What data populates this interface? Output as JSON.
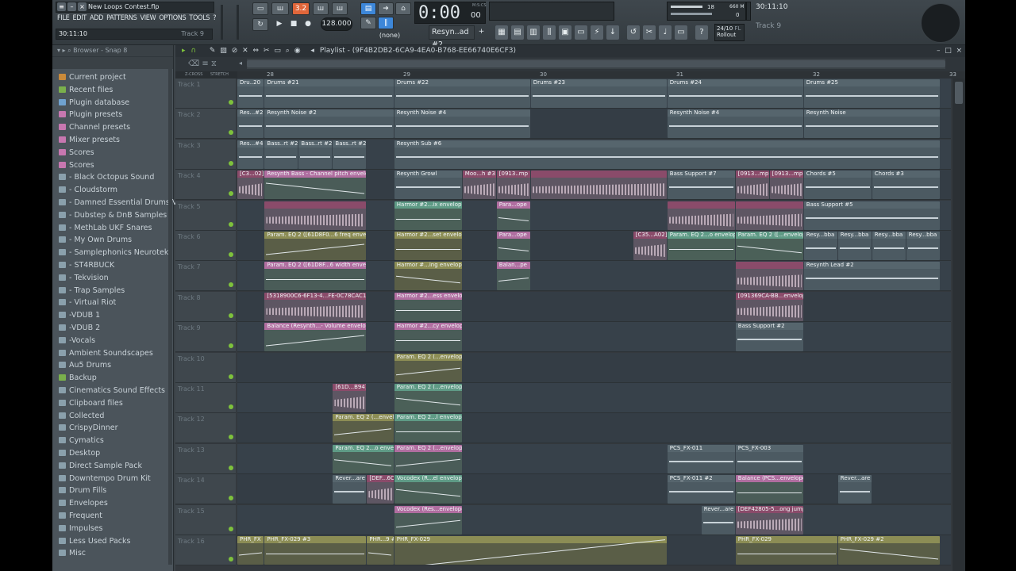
{
  "app": {
    "project_file": "New Loops Contest.flp",
    "menu": [
      "FILE",
      "EDIT",
      "ADD",
      "PATTERNS",
      "VIEW",
      "OPTIONS",
      "TOOLS",
      "?"
    ],
    "hint_time": "30:11:10",
    "hint_track": "Track 9",
    "pattern_num": "3.2",
    "tempo": "128.000",
    "time_display": "0:00",
    "time_sub": "00",
    "time_unit": "M:S:CS",
    "snap_label": "(none)",
    "pattern_selector": "Resyn..ad #2",
    "cpu_value": "18",
    "mem_value": "660 M",
    "voices": "0",
    "top_hint_time": "30:11:10",
    "top_hint_track": "Track 9",
    "rollout_date": "24/10",
    "rollout_label": "Rollout",
    "fl_label": "FL"
  },
  "browser": {
    "header": "Browser - Snap 8",
    "items": [
      {
        "label": "Current project",
        "color": "#c98a3a"
      },
      {
        "label": "Recent files",
        "color": "#7ab04c"
      },
      {
        "label": "Plugin database",
        "color": "#6fa2d0"
      },
      {
        "label": "Plugin presets",
        "color": "#c777b0"
      },
      {
        "label": "Channel presets",
        "color": "#c777b0"
      },
      {
        "label": "Mixer presets",
        "color": "#c777b0"
      },
      {
        "label": "Scores",
        "color": "#c777b0"
      },
      {
        "label": "Scores",
        "color": "#c777b0"
      },
      {
        "label": "- Black Octopus Sound",
        "color": "#8aa0ac"
      },
      {
        "label": "- Cloudstorm",
        "color": "#8aa0ac"
      },
      {
        "label": "- Damned Essential Drums V2",
        "color": "#8aa0ac"
      },
      {
        "label": "- Dubstep & DnB Samples",
        "color": "#8aa0ac"
      },
      {
        "label": "- MethLab UKF Snares",
        "color": "#8aa0ac"
      },
      {
        "label": "- My Own Drums",
        "color": "#8aa0ac"
      },
      {
        "label": "- Samplephonics Neurotek",
        "color": "#8aa0ac"
      },
      {
        "label": "- ST4RBUCK",
        "color": "#8aa0ac"
      },
      {
        "label": "- Tekvision",
        "color": "#8aa0ac"
      },
      {
        "label": "- Trap Samples",
        "color": "#8aa0ac"
      },
      {
        "label": "- Virtual Riot",
        "color": "#8aa0ac"
      },
      {
        "label": "-VDUB 1",
        "color": "#8aa0ac"
      },
      {
        "label": "-VDUB 2",
        "color": "#8aa0ac"
      },
      {
        "label": "-Vocals",
        "color": "#8aa0ac"
      },
      {
        "label": "Ambient Soundscapes",
        "color": "#8aa0ac"
      },
      {
        "label": "Au5 Drums",
        "color": "#8aa0ac"
      },
      {
        "label": "Backup",
        "color": "#7ab04c"
      },
      {
        "label": "Cinematics Sound Effects",
        "color": "#8aa0ac"
      },
      {
        "label": "Clipboard files",
        "color": "#8aa0ac"
      },
      {
        "label": "Collected",
        "color": "#8aa0ac"
      },
      {
        "label": "CrispyDinner",
        "color": "#8aa0ac"
      },
      {
        "label": "Cymatics",
        "color": "#8aa0ac"
      },
      {
        "label": "Desktop",
        "color": "#8aa0ac"
      },
      {
        "label": "Direct Sample Pack",
        "color": "#8aa0ac"
      },
      {
        "label": "Downtempo Drum Kit",
        "color": "#8aa0ac"
      },
      {
        "label": "Drum Fills",
        "color": "#8aa0ac"
      },
      {
        "label": "Envelopes",
        "color": "#8aa0ac"
      },
      {
        "label": "Frequent",
        "color": "#8aa0ac"
      },
      {
        "label": "Impulses",
        "color": "#8aa0ac"
      },
      {
        "label": "Less Used Packs",
        "color": "#8aa0ac"
      },
      {
        "label": "Misc",
        "color": "#8aa0ac"
      }
    ]
  },
  "playlist": {
    "title": "Playlist - (9F4B2DB2-6CA9-4EA0-B768-EE66740E6CF3)",
    "zoom_labels": [
      "Z-CROSS",
      "STRETCH"
    ],
    "ruler": [
      "28",
      "29",
      "30",
      "31",
      "32",
      "33"
    ],
    "tracks": [
      "Track 1",
      "Track 2",
      "Track 3",
      "Track 4",
      "Track 5",
      "Track 6",
      "Track 7",
      "Track 8",
      "Track 9",
      "Track 10",
      "Track 11",
      "Track 12",
      "Track 13",
      "Track 14",
      "Track 15",
      "Track 16"
    ],
    "clips": [
      {
        "t": 0,
        "s": 0,
        "w": 0.4,
        "k": "pat",
        "l": "Dru..20"
      },
      {
        "t": 0,
        "s": 0.4,
        "w": 1.9,
        "k": "pat",
        "l": "Drums #21"
      },
      {
        "t": 0,
        "s": 2.3,
        "w": 2.0,
        "k": "pat",
        "l": "Drums #22"
      },
      {
        "t": 0,
        "s": 4.3,
        "w": 2.0,
        "k": "pat",
        "l": "Drums #23"
      },
      {
        "t": 0,
        "s": 6.3,
        "w": 2.0,
        "k": "pat",
        "l": "Drums #24"
      },
      {
        "t": 0,
        "s": 8.3,
        "w": 2.0,
        "k": "pat",
        "l": "Drums #25"
      },
      {
        "t": 1,
        "s": 0,
        "w": 0.4,
        "k": "pat",
        "l": "Res...#2"
      },
      {
        "t": 1,
        "s": 0.4,
        "w": 1.9,
        "k": "pat",
        "l": "Resynth Noise #2"
      },
      {
        "t": 1,
        "s": 2.3,
        "w": 2.0,
        "k": "pat",
        "l": "Resynth Noise #4"
      },
      {
        "t": 1,
        "s": 6.3,
        "w": 2.0,
        "k": "pat",
        "l": "Resynth Noise #4"
      },
      {
        "t": 1,
        "s": 8.3,
        "w": 2.0,
        "k": "pat",
        "l": "Resynth Noise"
      },
      {
        "t": 2,
        "s": 0,
        "w": 0.4,
        "k": "pat",
        "l": "Res...#4"
      },
      {
        "t": 2,
        "s": 0.4,
        "w": 0.5,
        "k": "pat",
        "l": "Bass..rt #2"
      },
      {
        "t": 2,
        "s": 0.9,
        "w": 0.5,
        "k": "pat",
        "l": "Bass..rt #2"
      },
      {
        "t": 2,
        "s": 1.4,
        "w": 0.5,
        "k": "pat",
        "l": "Bass..rt #2"
      },
      {
        "t": 2,
        "s": 2.3,
        "w": 8.0,
        "k": "pat",
        "l": "Resynth Sub #6"
      },
      {
        "t": 3,
        "s": 0,
        "w": 0.4,
        "k": "aud",
        "l": "[C3...02]"
      },
      {
        "t": 3,
        "s": 0.4,
        "w": 1.5,
        "k": "env",
        "l": "Resynth Bass - Channel pitch envelope"
      },
      {
        "t": 3,
        "s": 2.3,
        "w": 1.0,
        "k": "pat",
        "l": "Resynth Growl"
      },
      {
        "t": 3,
        "s": 3.3,
        "w": 0.5,
        "k": "aud",
        "l": "Moo...h #3"
      },
      {
        "t": 3,
        "s": 3.8,
        "w": 0.5,
        "k": "aud",
        "l": "[0913..mp"
      },
      {
        "t": 3,
        "s": 4.3,
        "w": 2.0,
        "k": "aud",
        "l": ""
      },
      {
        "t": 3,
        "s": 6.3,
        "w": 1.0,
        "k": "pat",
        "l": "Bass Support #7"
      },
      {
        "t": 3,
        "s": 7.3,
        "w": 0.5,
        "k": "aud",
        "l": "[0913...mp"
      },
      {
        "t": 3,
        "s": 7.8,
        "w": 0.5,
        "k": "aud",
        "l": "[0913...mp"
      },
      {
        "t": 3,
        "s": 8.3,
        "w": 1.0,
        "k": "pat",
        "l": "Chords #5"
      },
      {
        "t": 3,
        "s": 9.3,
        "w": 1.0,
        "k": "pat",
        "l": "Chords #3"
      },
      {
        "t": 4,
        "s": 0.4,
        "w": 1.5,
        "k": "aud",
        "l": ""
      },
      {
        "t": 4,
        "s": 2.3,
        "w": 1.0,
        "k": "grn",
        "l": "Harmor #2...ix envelope"
      },
      {
        "t": 4,
        "s": 3.8,
        "w": 0.5,
        "k": "env",
        "l": "Para...ope"
      },
      {
        "t": 4,
        "s": 6.3,
        "w": 1.0,
        "k": "aud",
        "l": ""
      },
      {
        "t": 4,
        "s": 7.3,
        "w": 1.0,
        "k": "aud",
        "l": ""
      },
      {
        "t": 4,
        "s": 8.3,
        "w": 2.0,
        "k": "pat",
        "l": "Bass Support #5"
      },
      {
        "t": 5,
        "s": 0.4,
        "w": 1.5,
        "k": "env2",
        "l": "Param. EQ 2 ([61D8F0...6 freq envelope"
      },
      {
        "t": 5,
        "s": 2.3,
        "w": 1.0,
        "k": "env2",
        "l": "Harmor #2...set envelope"
      },
      {
        "t": 5,
        "s": 3.8,
        "w": 0.5,
        "k": "env",
        "l": "Para...ope"
      },
      {
        "t": 5,
        "s": 5.8,
        "w": 0.5,
        "k": "aud",
        "l": "[C35...A02]"
      },
      {
        "t": 5,
        "s": 6.3,
        "w": 1.0,
        "k": "grn",
        "l": "Param. EQ 2...o envelope"
      },
      {
        "t": 5,
        "s": 7.3,
        "w": 1.0,
        "k": "grn",
        "l": "Param. EQ 2 ([...envelope"
      },
      {
        "t": 5,
        "s": 8.3,
        "w": 0.5,
        "k": "pat",
        "l": "Resy...bba"
      },
      {
        "t": 5,
        "s": 8.8,
        "w": 0.5,
        "k": "pat",
        "l": "Resy...bba"
      },
      {
        "t": 5,
        "s": 9.3,
        "w": 0.5,
        "k": "pat",
        "l": "Resy...bba"
      },
      {
        "t": 5,
        "s": 9.8,
        "w": 0.5,
        "k": "pat",
        "l": "Resy...bba"
      },
      {
        "t": 6,
        "s": 0.4,
        "w": 1.5,
        "k": "env",
        "l": "Param. EQ 2 ([61D8F...6 width envelope"
      },
      {
        "t": 6,
        "s": 2.3,
        "w": 1.0,
        "k": "env2",
        "l": "Harmor #...ing envelope"
      },
      {
        "t": 6,
        "s": 3.8,
        "w": 0.5,
        "k": "env",
        "l": "Balan...pe"
      },
      {
        "t": 6,
        "s": 7.3,
        "w": 1.0,
        "k": "aud",
        "l": ""
      },
      {
        "t": 6,
        "s": 8.3,
        "w": 2.0,
        "k": "pat",
        "l": "Resynth Lead #2"
      },
      {
        "t": 7,
        "s": 0.4,
        "w": 1.5,
        "k": "aud",
        "l": "[5318900C6-6F13-4...FE-0C78CAC190C8]"
      },
      {
        "t": 7,
        "s": 2.3,
        "w": 1.0,
        "k": "env",
        "l": "Harmor #2...ess envelope"
      },
      {
        "t": 7,
        "s": 7.3,
        "w": 1.0,
        "k": "aud",
        "l": "[091369CA-BB...envelope"
      },
      {
        "t": 8,
        "s": 0.4,
        "w": 1.5,
        "k": "env",
        "l": "Balance (Resynth...- Volume envelope"
      },
      {
        "t": 8,
        "s": 2.3,
        "w": 1.0,
        "k": "env",
        "l": "Harmor #2...cy envelope"
      },
      {
        "t": 8,
        "s": 7.3,
        "w": 1.0,
        "k": "pat",
        "l": "Bass Support #2"
      },
      {
        "t": 9,
        "s": 2.3,
        "w": 1.0,
        "k": "env2",
        "l": "Param. EQ 2 (...envelope"
      },
      {
        "t": 10,
        "s": 1.4,
        "w": 0.5,
        "k": "aud",
        "l": "[61D...B94]"
      },
      {
        "t": 10,
        "s": 2.3,
        "w": 1.0,
        "k": "grn",
        "l": "Param. EQ 2 (...envelope"
      },
      {
        "t": 11,
        "s": 1.4,
        "w": 0.9,
        "k": "env2",
        "l": "Param. EQ 2 (...envelope"
      },
      {
        "t": 11,
        "s": 2.3,
        "w": 1.0,
        "k": "grn",
        "l": "Param. EQ 2...l envelope"
      },
      {
        "t": 12,
        "s": 1.4,
        "w": 0.9,
        "k": "grn",
        "l": "Param. EQ 2...o envelope"
      },
      {
        "t": 12,
        "s": 2.3,
        "w": 1.0,
        "k": "env",
        "l": "Param. EQ 2 (...envelope"
      },
      {
        "t": 12,
        "s": 6.3,
        "w": 1.0,
        "k": "pat",
        "l": "PCS_FX-011"
      },
      {
        "t": 12,
        "s": 7.3,
        "w": 1.0,
        "k": "pat",
        "l": "PCS_FX-003"
      },
      {
        "t": 13,
        "s": 1.4,
        "w": 0.5,
        "k": "pat",
        "l": "Rever...are"
      },
      {
        "t": 13,
        "s": 1.9,
        "w": 0.4,
        "k": "aud",
        "l": "[DEF...6C8]"
      },
      {
        "t": 13,
        "s": 2.3,
        "w": 1.0,
        "k": "grn",
        "l": "Vocodex (R...el envelope"
      },
      {
        "t": 13,
        "s": 6.3,
        "w": 1.0,
        "k": "pat",
        "l": "PCS_FX-011 #2"
      },
      {
        "t": 13,
        "s": 7.3,
        "w": 1.0,
        "k": "env",
        "l": "Balance (PCS...envelope"
      },
      {
        "t": 13,
        "s": 8.8,
        "w": 0.5,
        "k": "pat",
        "l": "Rever...are"
      },
      {
        "t": 14,
        "s": 2.3,
        "w": 1.0,
        "k": "env",
        "l": "Vocodex (Res...envelope"
      },
      {
        "t": 14,
        "s": 6.8,
        "w": 0.5,
        "k": "pat",
        "l": "Rever...are"
      },
      {
        "t": 14,
        "s": 7.3,
        "w": 1.0,
        "k": "aud",
        "l": "[DEF42805-5...ong jump"
      },
      {
        "t": 15,
        "s": 0,
        "w": 0.4,
        "k": "env2",
        "l": "PHR_FX"
      },
      {
        "t": 15,
        "s": 0.4,
        "w": 1.5,
        "k": "env2",
        "l": "PHR_FX-029 #3"
      },
      {
        "t": 15,
        "s": 1.9,
        "w": 0.4,
        "k": "env2",
        "l": "PHR...9 #3"
      },
      {
        "t": 15,
        "s": 2.3,
        "w": 4.0,
        "k": "env2",
        "l": "PHR_FX-029"
      },
      {
        "t": 15,
        "s": 7.3,
        "w": 1.5,
        "k": "env2",
        "l": "PHR_FX-029"
      },
      {
        "t": 15,
        "s": 8.8,
        "w": 1.5,
        "k": "env2",
        "l": "PHR_FX-029 #2"
      }
    ]
  }
}
